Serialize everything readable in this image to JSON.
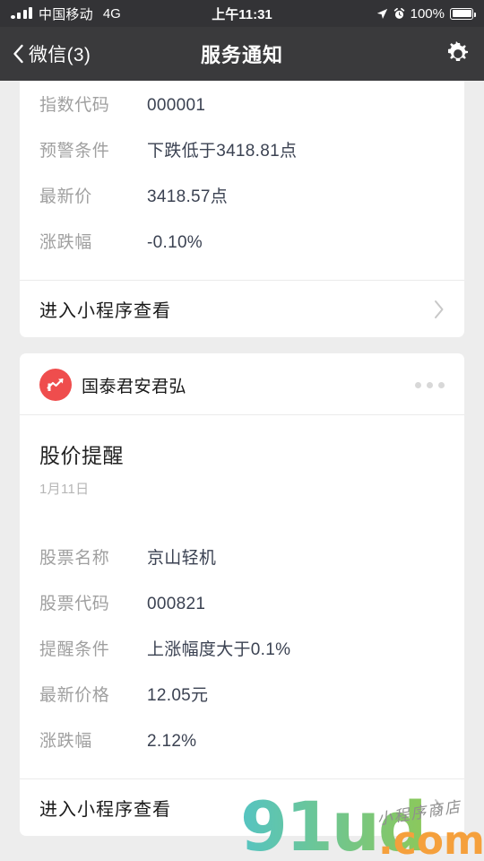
{
  "status_bar": {
    "carrier": "中国移动",
    "network": "4G",
    "time": "上午11:31",
    "battery_percent": "100%",
    "icons": [
      "signal-bars-icon",
      "location-arrow-icon",
      "alarm-clock-icon",
      "battery-icon"
    ]
  },
  "nav_bar": {
    "back_label": "微信(3)",
    "title": "服务通知",
    "back_icon": "chevron-left-icon",
    "settings_icon": "gear-icon"
  },
  "cards": [
    {
      "clipped": true,
      "rows": [
        {
          "key": "指数代码",
          "value": "000001"
        },
        {
          "key": "预警条件",
          "value": "下跌低于3418.81点"
        },
        {
          "key": "最新价",
          "value": "3418.57点"
        },
        {
          "key": "涨跌幅",
          "value": "-0.10%"
        }
      ],
      "footer_label": "进入小程序查看",
      "footer_icon": "chevron-right-icon"
    },
    {
      "clipped": false,
      "app_name": "国泰君安君弘",
      "avatar_icon": "trending-up-chart-icon",
      "avatar_color": "#ef4d4d",
      "more_icon": "more-horizontal-icon",
      "message_title": "股价提醒",
      "message_date": "1月11日",
      "rows": [
        {
          "key": "股票名称",
          "value": "京山轻机"
        },
        {
          "key": "股票代码",
          "value": "000821"
        },
        {
          "key": "提醒条件",
          "value": "上涨幅度大于0.1%"
        },
        {
          "key": "最新价格",
          "value": "12.05元"
        },
        {
          "key": "涨跌幅",
          "value": "2.12%"
        }
      ],
      "footer_label": "进入小程序查看",
      "footer_icon": "chevron-right-icon"
    }
  ],
  "watermark": {
    "logo_text": "91ud",
    "domain_text": ".com",
    "handwriting": "小程序商店",
    "colors": {
      "logo_start": "#55c4c2",
      "logo_end": "#8cc85a",
      "domain": "#f5a03c"
    }
  },
  "theme": {
    "page_bg": "#ededed",
    "card_bg": "#ffffff",
    "nav_bg": "#3a3a3c",
    "status_bg": "#333336",
    "key_color": "#a0a0a0",
    "value_color": "#3b4252"
  }
}
